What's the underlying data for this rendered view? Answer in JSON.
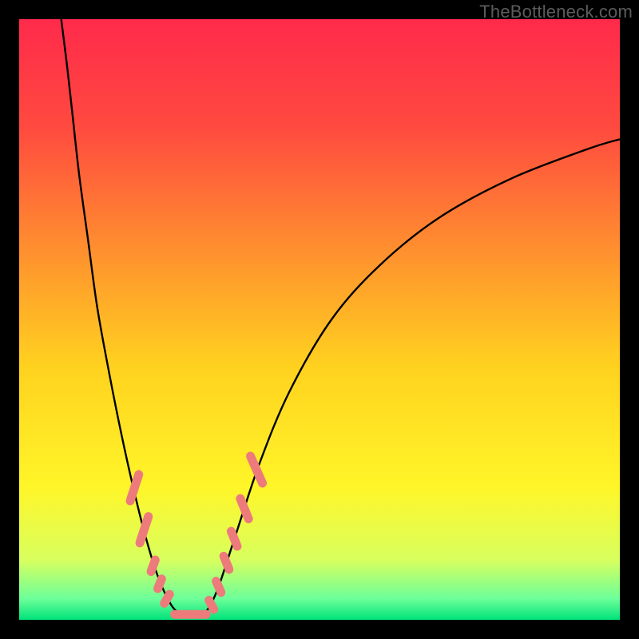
{
  "watermark": "TheBottleneck.com",
  "chart_data": {
    "type": "line",
    "title": "",
    "xlabel": "",
    "ylabel": "",
    "xlim": [
      0,
      100
    ],
    "ylim": [
      0,
      100
    ],
    "background_gradient_stops": [
      {
        "offset": 0.0,
        "color": "#ff2a4b"
      },
      {
        "offset": 0.18,
        "color": "#ff4a3f"
      },
      {
        "offset": 0.38,
        "color": "#ff8e2f"
      },
      {
        "offset": 0.58,
        "color": "#ffd21f"
      },
      {
        "offset": 0.78,
        "color": "#fff629"
      },
      {
        "offset": 0.9,
        "color": "#d8ff5e"
      },
      {
        "offset": 0.965,
        "color": "#6cff9a"
      },
      {
        "offset": 1.0,
        "color": "#00e27a"
      }
    ],
    "series": [
      {
        "name": "left-descent",
        "stroke": "#000000",
        "values": [
          {
            "x": 7.0,
            "y": 100.0
          },
          {
            "x": 8.0,
            "y": 92.0
          },
          {
            "x": 9.0,
            "y": 83.0
          },
          {
            "x": 10.0,
            "y": 74.0
          },
          {
            "x": 11.5,
            "y": 63.0
          },
          {
            "x": 13.0,
            "y": 52.0
          },
          {
            "x": 15.0,
            "y": 41.0
          },
          {
            "x": 17.0,
            "y": 31.0
          },
          {
            "x": 19.0,
            "y": 22.0
          },
          {
            "x": 21.0,
            "y": 14.0
          },
          {
            "x": 23.0,
            "y": 7.5
          },
          {
            "x": 25.0,
            "y": 3.0
          },
          {
            "x": 26.5,
            "y": 1.2
          }
        ]
      },
      {
        "name": "valley-floor",
        "stroke": "#000000",
        "values": [
          {
            "x": 26.5,
            "y": 1.2
          },
          {
            "x": 28.0,
            "y": 0.8
          },
          {
            "x": 29.5,
            "y": 0.8
          },
          {
            "x": 31.0,
            "y": 1.2
          }
        ]
      },
      {
        "name": "right-ascent",
        "stroke": "#000000",
        "values": [
          {
            "x": 31.0,
            "y": 1.2
          },
          {
            "x": 33.0,
            "y": 5.0
          },
          {
            "x": 36.0,
            "y": 14.0
          },
          {
            "x": 40.0,
            "y": 26.0
          },
          {
            "x": 45.0,
            "y": 38.0
          },
          {
            "x": 52.0,
            "y": 50.0
          },
          {
            "x": 60.0,
            "y": 59.0
          },
          {
            "x": 70.0,
            "y": 67.0
          },
          {
            "x": 82.0,
            "y": 73.5
          },
          {
            "x": 95.0,
            "y": 78.5
          },
          {
            "x": 100.0,
            "y": 80.0
          }
        ]
      }
    ],
    "markers": {
      "color": "#ed7b7b",
      "shape": "rounded-rect",
      "points": [
        {
          "x": 19.2,
          "y": 22.0,
          "len": 3.8,
          "angle": -72
        },
        {
          "x": 20.8,
          "y": 15.0,
          "len": 3.8,
          "angle": -72
        },
        {
          "x": 22.3,
          "y": 9.0,
          "len": 2.2,
          "angle": -70
        },
        {
          "x": 23.4,
          "y": 6.0,
          "len": 2.0,
          "angle": -68
        },
        {
          "x": 24.6,
          "y": 3.5,
          "len": 2.0,
          "angle": -60
        },
        {
          "x": 28.5,
          "y": 0.9,
          "len": 4.2,
          "angle": 0
        },
        {
          "x": 32.0,
          "y": 2.5,
          "len": 2.0,
          "angle": 62
        },
        {
          "x": 33.2,
          "y": 5.5,
          "len": 2.2,
          "angle": 66
        },
        {
          "x": 34.5,
          "y": 9.5,
          "len": 2.4,
          "angle": 68
        },
        {
          "x": 35.8,
          "y": 13.5,
          "len": 2.6,
          "angle": 68
        },
        {
          "x": 37.5,
          "y": 18.5,
          "len": 3.2,
          "angle": 68
        },
        {
          "x": 39.5,
          "y": 25.0,
          "len": 4.0,
          "angle": 66
        }
      ]
    }
  }
}
